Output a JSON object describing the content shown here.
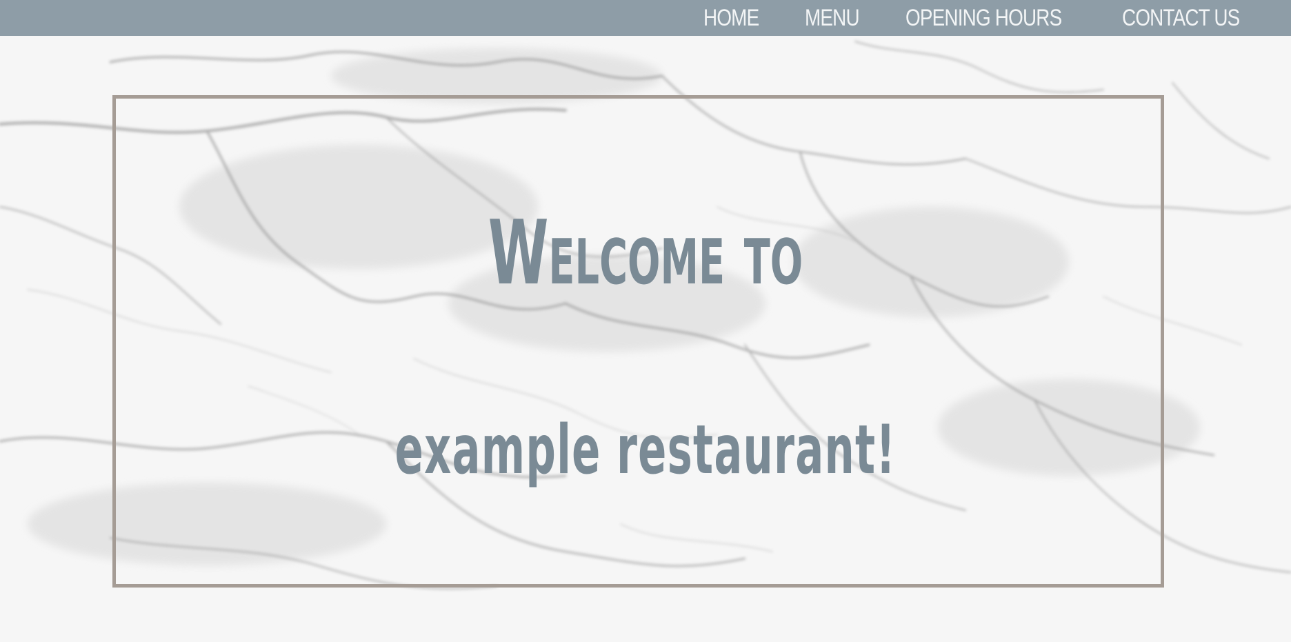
{
  "nav": {
    "items": [
      {
        "label": "HOME"
      },
      {
        "label": "MENU"
      },
      {
        "label": "OPENING HOURS"
      },
      {
        "label": "CONTACT US"
      }
    ]
  },
  "hero": {
    "title_line1": "Welcome to",
    "title_line2": "example restaurant!"
  },
  "colors": {
    "navbar_bg": "#8e9da7",
    "nav_text": "#f3f5f6",
    "heading_text": "#7a8a95",
    "frame_border": "#a59c95",
    "background": "marble-white"
  }
}
